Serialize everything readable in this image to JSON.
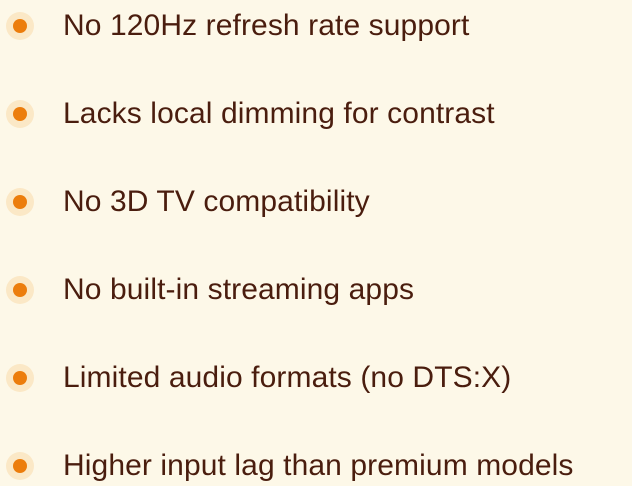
{
  "colors": {
    "background": "#fdf8e8",
    "bullet_ring": "#fbe8c6",
    "bullet_dot": "#ec7d0c",
    "text": "#4a1d0e"
  },
  "icons": {
    "bullet": "bullet-dot-icon"
  },
  "cons": [
    "No 120Hz refresh rate support",
    "Lacks local dimming for contrast",
    "No 3D TV compatibility",
    "No built-in streaming apps",
    "Limited audio formats (no DTS:X)",
    "Higher input lag than premium models"
  ]
}
